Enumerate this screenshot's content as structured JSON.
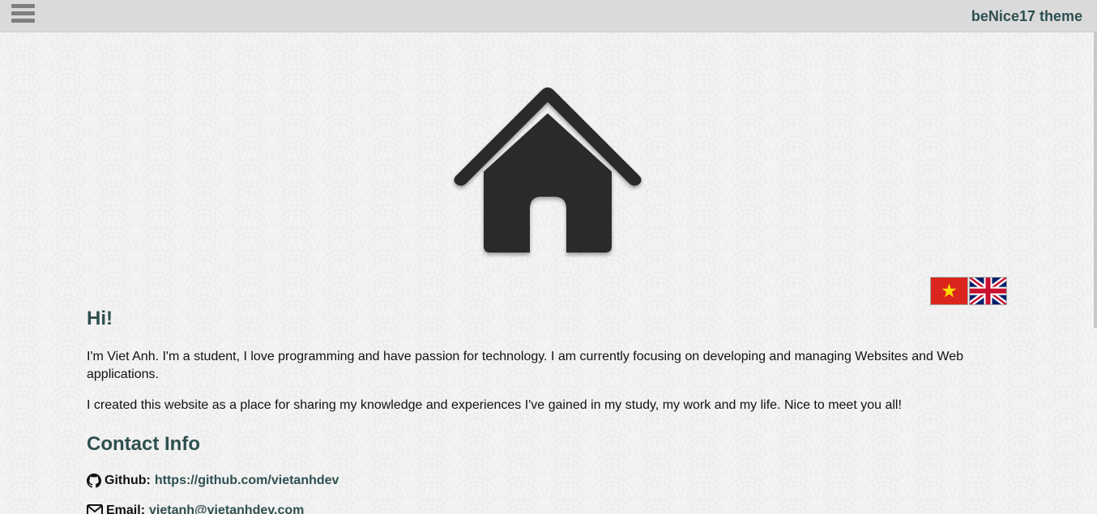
{
  "header": {
    "theme_title": "beNice17 theme",
    "menu_icon": "hamburger-menu-icon"
  },
  "hero": {
    "icon": "home-icon"
  },
  "language_flags": [
    {
      "code": "vi",
      "icon": "vietnam-flag-icon"
    },
    {
      "code": "en",
      "icon": "uk-flag-icon"
    }
  ],
  "main": {
    "greeting": "Hi!",
    "paragraph1": "I'm Viet Anh. I'm a student, I love programming and have passion for technology. I am currently focusing on developing and managing Websites and Web applications.",
    "paragraph2": "I created this website as a place for sharing my knowledge and experiences I've gained in my study, my work and my life. Nice to meet you all!",
    "contact_title": "Contact Info",
    "contacts": [
      {
        "label": "Github:",
        "value": "https://github.com/vietanhdev",
        "icon": "github-icon"
      },
      {
        "label": "Email:",
        "value": "vietanh@vietanhdev.com",
        "icon": "email-icon"
      }
    ]
  },
  "colors": {
    "accent": "#2f4f4f",
    "topbar": "#dadada",
    "icon_dark": "#2c2b2c"
  }
}
